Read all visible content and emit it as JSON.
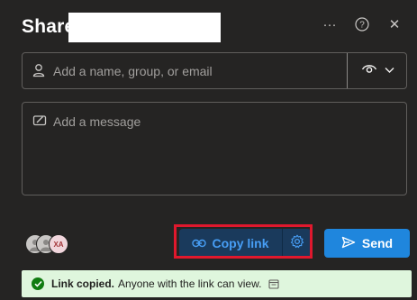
{
  "header": {
    "title": "Share",
    "more_label": "···",
    "help_label": "?",
    "close_label": "✕"
  },
  "people_field": {
    "placeholder": "Add a name, group, or email",
    "permission_icon": "eye-icon"
  },
  "message_field": {
    "placeholder": "Add a message"
  },
  "avatars": {
    "initials": "XA"
  },
  "actions": {
    "copy_link_label": "Copy link",
    "send_label": "Send"
  },
  "toast": {
    "bold_text": "Link copied.",
    "text": "Anyone with the link can view."
  },
  "colors": {
    "accent": "#479ef5",
    "send": "#1f86dd",
    "highlight": "#e0182d",
    "toast_bg": "#dff6dd",
    "success": "#107c10"
  }
}
